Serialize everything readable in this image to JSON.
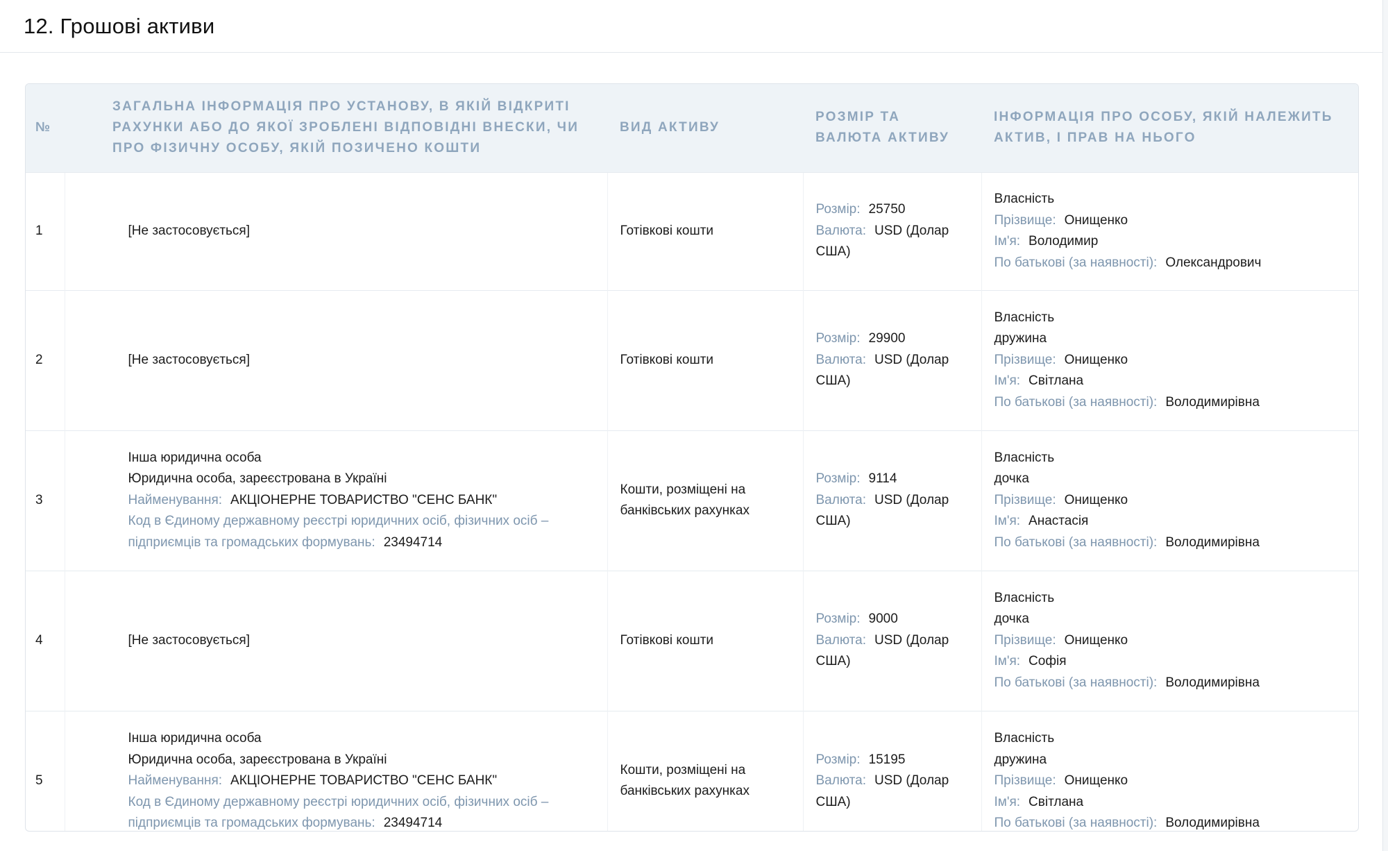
{
  "section": {
    "title": "12. Грошові активи"
  },
  "table": {
    "headers": {
      "num": "№",
      "institution": "Загальна інформація про установу, в якій відкриті рахунки або до якої зроблені відповідні внески, чи про фізичну особу, якій позичено кошти",
      "asset_kind": "Вид активу",
      "size_currency": "Розмір та валюта активу",
      "owner": "Інформація про особу, якій належить актив, і прав на нього"
    },
    "labels": {
      "size": "Розмір:",
      "currency": "Валюта:",
      "surname": "Прізвище:",
      "name": "Ім'я:",
      "patronymic": "По батькові (за наявності):",
      "org_name": "Найменування:",
      "org_code": "Код в Єдиному державному реєстрі юридичних осіб, фізичних осіб – підприємців та громадських формувань:"
    },
    "rows": [
      {
        "num": "1",
        "institution": {
          "not_applicable": "[Не застосовується]"
        },
        "asset_kind": "Готівкові кошти",
        "size": "25750",
        "currency": "USD (Долар США)",
        "owner": {
          "right": "Власність",
          "relation": "",
          "surname": "Онищенко",
          "name": "Володимир",
          "patronymic": "Олександрович"
        }
      },
      {
        "num": "2",
        "institution": {
          "not_applicable": "[Не застосовується]"
        },
        "asset_kind": "Готівкові кошти",
        "size": "29900",
        "currency": "USD (Долар США)",
        "owner": {
          "right": "Власність",
          "relation": "дружина",
          "surname": "Онищенко",
          "name": "Світлана",
          "patronymic": "Володимирівна"
        }
      },
      {
        "num": "3",
        "institution": {
          "type": "Інша юридична особа",
          "jurisdiction": "Юридична особа, зареєстрована в Україні",
          "org_name": "АКЦІОНЕРНЕ ТОВАРИСТВО \"СЕНС БАНК\"",
          "code": "23494714"
        },
        "asset_kind": "Кошти, розміщені на банківських рахунках",
        "size": "9114",
        "currency": "USD (Долар США)",
        "owner": {
          "right": "Власність",
          "relation": "дочка",
          "surname": "Онищенко",
          "name": "Анастасія",
          "patronymic": "Володимирівна"
        }
      },
      {
        "num": "4",
        "institution": {
          "not_applicable": "[Не застосовується]"
        },
        "asset_kind": "Готівкові кошти",
        "size": "9000",
        "currency": "USD (Долар США)",
        "owner": {
          "right": "Власність",
          "relation": "дочка",
          "surname": "Онищенко",
          "name": "Софія",
          "patronymic": "Володимирівна"
        }
      },
      {
        "num": "5",
        "institution": {
          "type": "Інша юридична особа",
          "jurisdiction": "Юридична особа, зареєстрована в Україні",
          "org_name": "АКЦІОНЕРНЕ ТОВАРИСТВО \"СЕНС БАНК\"",
          "code": "23494714"
        },
        "asset_kind": "Кошти, розміщені на банківських рахунках",
        "size": "15195",
        "currency": "USD (Долар США)",
        "owner": {
          "right": "Власність",
          "relation": "дружина",
          "surname": "Онищенко",
          "name": "Світлана",
          "patronymic": "Володимирівна"
        }
      }
    ]
  }
}
